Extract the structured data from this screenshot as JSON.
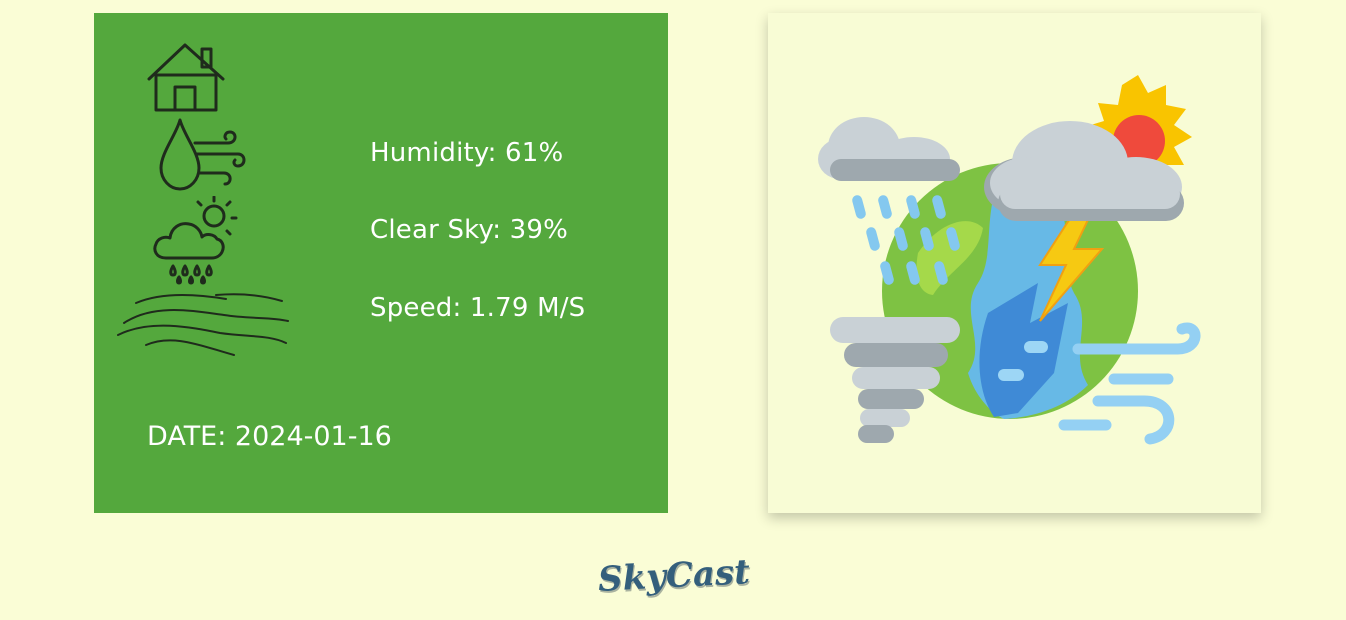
{
  "weather": {
    "humidity": "Humidity: 61%",
    "clear_sky": "Clear Sky: 39%",
    "speed": "Speed: 1.79 M/S",
    "date": "DATE: 2024-01-16"
  },
  "icons": {
    "location": "house-icon",
    "humidity": "water-drop-wind-icon",
    "sky": "cloud-sun-rain-icon",
    "wind": "wind-waves-icon",
    "illustration": "weather-globe-illustration"
  },
  "brand": {
    "name": "SkyCast"
  },
  "colors": {
    "background": "#fafdd6",
    "card": "#54a83d",
    "text": "#ffffff",
    "brand": "#345f7c"
  }
}
